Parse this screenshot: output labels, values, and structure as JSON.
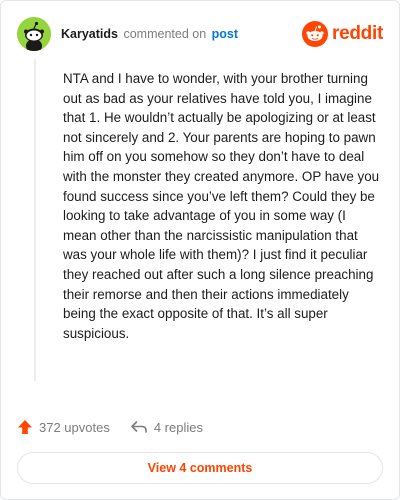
{
  "header": {
    "username": "Karyatids",
    "commented_text": "commented on",
    "post_link": "post",
    "brand": "reddit",
    "avatar_icon": "snoo-avatar-icon",
    "brand_icon": "reddit-logo-icon"
  },
  "comment": {
    "body": "NTA and I have to wonder, with your brother turning out as bad as your relatives have told you, I imagine that 1. He wouldn’t actually be apologizing or at least not sincerely and 2. Your parents are hoping to pawn him off on you somehow so they don’t have to deal with the monster they created anymore. OP have you found success since you’ve left them? Could they be looking to take advantage of you in some way (I mean other than the narcissistic manipulation that was your whole life with them)? I just find it peculiar they reached out after such a long silence preaching their remorse and then their actions immediately being the exact opposite of that. It’s all super suspicious."
  },
  "actions": {
    "upvotes": "372 upvotes",
    "replies": "4 replies",
    "upvote_icon": "upvote-arrow-icon",
    "reply_icon": "reply-arrow-icon"
  },
  "footer": {
    "view_comments": "View 4 comments"
  },
  "colors": {
    "brand_orange": "#ff4500",
    "link_blue": "#0079d3",
    "avatar_green": "#94d53e",
    "muted_text": "#7c7c7c"
  }
}
